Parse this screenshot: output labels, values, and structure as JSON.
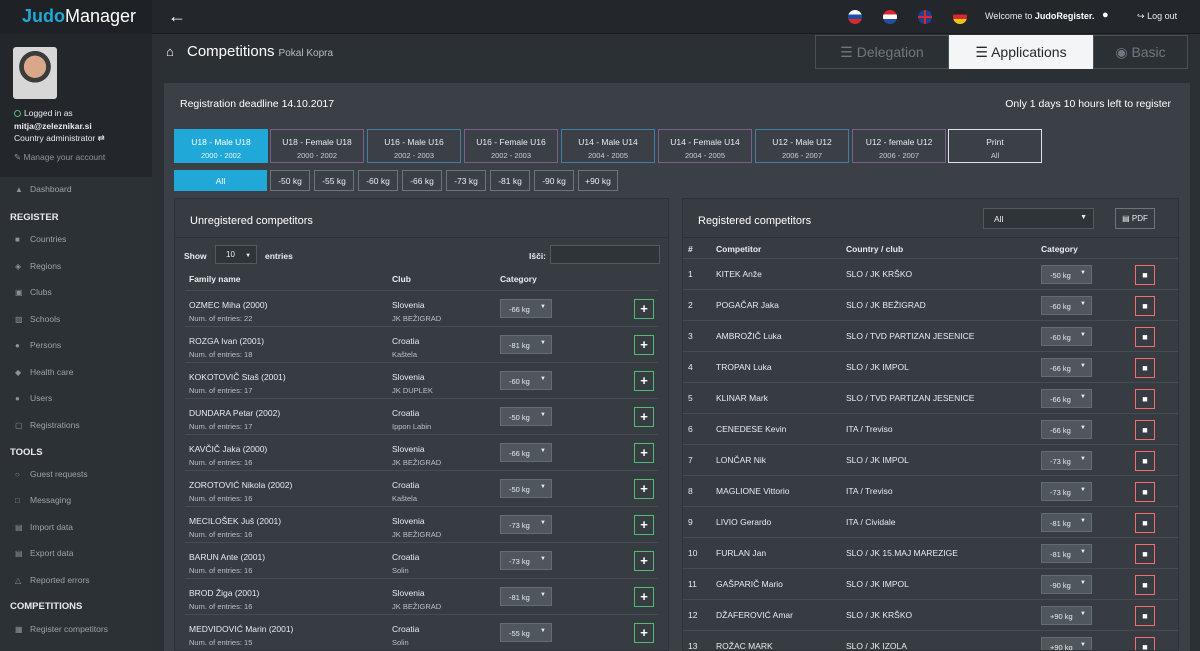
{
  "brand": {
    "part1": "Judo",
    "part2": "Manager"
  },
  "topbar": {
    "welcome_prefix": "Welcome to ",
    "welcome_app": "JudoRegister.",
    "logout": "Log out"
  },
  "user": {
    "status": "Logged in as",
    "email": "mitja@zeleznikar.si",
    "role": "Country administrator",
    "manage": "Manage your account"
  },
  "nav": {
    "dashboard": "Dashboard",
    "register_head": "REGISTER",
    "register": [
      "Countries",
      "Regions",
      "Clubs",
      "Schools",
      "Persons",
      "Health care",
      "Users",
      "Registrations"
    ],
    "tools_head": "TOOLS",
    "tools": [
      "Guest requests",
      "Messaging",
      "Import data",
      "Export data",
      "Reported errors"
    ],
    "competitions_head": "COMPETITIONS",
    "competitions": [
      "Register competitors"
    ]
  },
  "page": {
    "title": "Competitions",
    "subtitle": "Pokal Kopra"
  },
  "header_tabs": {
    "delegation": "Delegation",
    "applications": "Applications",
    "basic": "Basic"
  },
  "registration": {
    "deadline": "Registration deadline 14.10.2017",
    "time_left": "Only 1 days 10 hours left to register"
  },
  "categories": [
    {
      "label": "U18 - Male U18",
      "years": "2000 - 2002"
    },
    {
      "label": "U18 - Female U18",
      "years": "2000 - 2002"
    },
    {
      "label": "U16 - Male U16",
      "years": "2002 - 2003"
    },
    {
      "label": "U16 - Female U16",
      "years": "2002 - 2003"
    },
    {
      "label": "U14 - Male U14",
      "years": "2004 - 2005"
    },
    {
      "label": "U14 - Female U14",
      "years": "2004 - 2005"
    },
    {
      "label": "U12 - Male U12",
      "years": "2006 - 2007"
    },
    {
      "label": "U12 - female U12",
      "years": "2006 - 2007"
    },
    {
      "label": "Print",
      "years": "All"
    }
  ],
  "weights": [
    "All",
    "-50 kg",
    "-55 kg",
    "-60 kg",
    "-66 kg",
    "-73 kg",
    "-81 kg",
    "-90 kg",
    "+90 kg"
  ],
  "unregistered": {
    "title": "Unregistered competitors",
    "show_label": "Show",
    "entries_value": "10",
    "entries_label": "entries",
    "search_label": "Išči:",
    "columns": [
      "Family name",
      "Club",
      "Category"
    ],
    "rows": [
      {
        "name": "OZMEC Miha (2000)",
        "entries": "Num. of entries: 22",
        "country": "Slovenia",
        "club": "JK BEŽIGRAD",
        "category": "-66 kg"
      },
      {
        "name": "ROZGA Ivan (2001)",
        "entries": "Num. of entries: 18",
        "country": "Croatia",
        "club": "Kaštela",
        "category": "-81 kg"
      },
      {
        "name": "KOKOTOVIČ Staš (2001)",
        "entries": "Num. of entries: 17",
        "country": "Slovenia",
        "club": "JK DUPLEK",
        "category": "-60 kg"
      },
      {
        "name": "DUNDARA Petar (2002)",
        "entries": "Num. of entries: 17",
        "country": "Croatia",
        "club": "Ippon Labin",
        "category": "-50 kg"
      },
      {
        "name": "KAVČIČ Jaka (2000)",
        "entries": "Num. of entries: 16",
        "country": "Slovenia",
        "club": "JK BEŽIGRAD",
        "category": "-66 kg"
      },
      {
        "name": "ZOROTOVIĆ Nikola (2002)",
        "entries": "Num. of entries: 16",
        "country": "Croatia",
        "club": "Kaštela",
        "category": "-50 kg"
      },
      {
        "name": "MECILOŠEK Juš (2001)",
        "entries": "Num. of entries: 16",
        "country": "Slovenia",
        "club": "JK BEŽIGRAD",
        "category": "-73 kg"
      },
      {
        "name": "BARUN Ante (2001)",
        "entries": "Num. of entries: 16",
        "country": "Croatia",
        "club": "Solin",
        "category": "-73 kg"
      },
      {
        "name": "BROD Žiga (2001)",
        "entries": "Num. of entries: 16",
        "country": "Slovenia",
        "club": "JK BEŽIGRAD",
        "category": "-81 kg"
      },
      {
        "name": "MEDVIDOVIĆ Marin (2001)",
        "entries": "Num. of entries: 15",
        "country": "Croatia",
        "club": "Solin",
        "category": "-55 kg"
      }
    ]
  },
  "registered": {
    "title": "Registered competitors",
    "filter_value": "All",
    "pdf_label": "PDF",
    "columns": [
      "#",
      "Competitor",
      "Country / club",
      "Category"
    ],
    "rows": [
      {
        "num": "1",
        "name": "KITEK Anže",
        "club": "SLO / JK KRŠKO",
        "category": "-50 kg"
      },
      {
        "num": "2",
        "name": "POGAČAR Jaka",
        "club": "SLO / JK BEŽIGRAD",
        "category": "-60 kg"
      },
      {
        "num": "3",
        "name": "AMBROŽIČ Luka",
        "club": "SLO / TVD PARTIZAN JESENICE",
        "category": "-60 kg"
      },
      {
        "num": "4",
        "name": "TROPAN Luka",
        "club": "SLO / JK IMPOL",
        "category": "-66 kg"
      },
      {
        "num": "5",
        "name": "KLINAR Mark",
        "club": "SLO / TVD PARTIZAN JESENICE",
        "category": "-66 kg"
      },
      {
        "num": "6",
        "name": "CENEDESE Kevin",
        "club": "ITA / Treviso",
        "category": "-66 kg"
      },
      {
        "num": "7",
        "name": "LONČAR Nik",
        "club": "SLO / JK IMPOL",
        "category": "-73 kg"
      },
      {
        "num": "8",
        "name": "MAGLIONE Vittorio",
        "club": "ITA / Treviso",
        "category": "-73 kg"
      },
      {
        "num": "9",
        "name": "LIVIO Gerardo",
        "club": "ITA / Cividale",
        "category": "-81 kg"
      },
      {
        "num": "10",
        "name": "FURLAN Jan",
        "club": "SLO / JK 15.MAJ MAREZIGE",
        "category": "-81 kg"
      },
      {
        "num": "11",
        "name": "GAŠPARIČ Mario",
        "club": "SLO / JK IMPOL",
        "category": "-90 kg"
      },
      {
        "num": "12",
        "name": "DŽAFEROVIĆ Amar",
        "club": "SLO / JK KRŠKO",
        "category": "+90 kg"
      },
      {
        "num": "13",
        "name": "ROŽAC MARK",
        "club": "SLO / JK IZOLA",
        "category": "+90 kg"
      }
    ]
  },
  "colors": {
    "accent": "#20a8d8",
    "success": "#4dbd74",
    "danger": "#f86c6b",
    "sidebar": "#2c3136",
    "content": "#3a4046"
  },
  "icons": {
    "back": "arrow-left-icon",
    "home": "home-icon",
    "bell": "bell-icon",
    "logout": "logout-icon",
    "add": "plus-icon",
    "delete": "trash-icon",
    "pdf": "file-pdf-icon",
    "shuffle": "shuffle-icon"
  }
}
